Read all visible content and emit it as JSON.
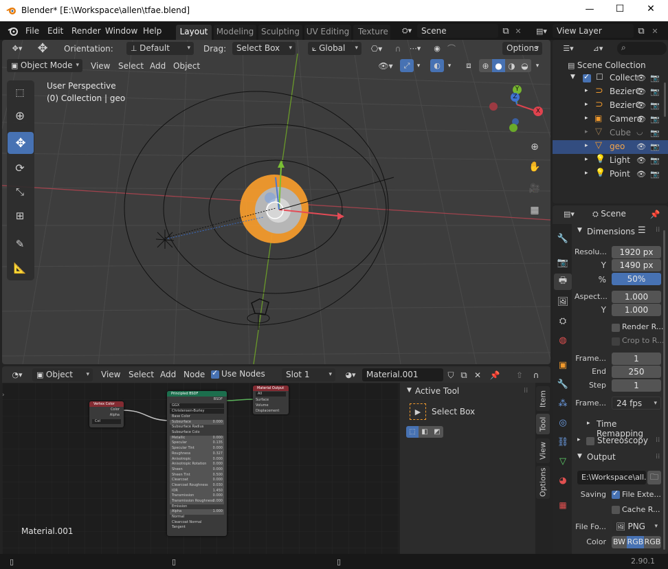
{
  "window": {
    "title": "Blender* [E:\\Workspace\\allen\\tfae.blend]",
    "minimize": "—",
    "maximize": "☐",
    "close": "✕"
  },
  "topbar": {
    "menus": [
      "File",
      "Edit",
      "Render",
      "Window",
      "Help"
    ],
    "workspaces": [
      "Layout",
      "Modeling",
      "Sculpting",
      "UV Editing",
      "Texture P"
    ],
    "active_workspace": "Layout",
    "scene": "Scene",
    "view_layer": "View Layer"
  },
  "tool_header": {
    "orientation_label": "Orientation:",
    "orientation_value": "Default",
    "drag_label": "Drag:",
    "drag_value": "Select Box",
    "transform_orientation": "Global",
    "options": "Options"
  },
  "viewport_header": {
    "mode": "Object Mode",
    "menus": [
      "View",
      "Select",
      "Add",
      "Object"
    ]
  },
  "viewport": {
    "perspective": "User Perspective",
    "collection_info": "(0) Collection | geo",
    "gizmo_axes": {
      "x": "X",
      "y": "Y",
      "z": "Z"
    }
  },
  "node_header": {
    "type": "Object",
    "menus": [
      "View",
      "Select",
      "Add",
      "Node"
    ],
    "use_nodes": "Use Nodes",
    "slot": "Slot 1",
    "material": "Material.001"
  },
  "node_editor": {
    "material_label": "Material.001",
    "nodes": {
      "vertex_color": {
        "title": "Vertex Color",
        "outputs": [
          "Color",
          "Alpha"
        ],
        "field": "Col"
      },
      "principled": {
        "title": "Principled BSDF",
        "output": "BSDF",
        "distribution": "GGX",
        "subsurface_method": "Christensen-Burley",
        "rows": [
          {
            "name": "Base Color",
            "value": ""
          },
          {
            "name": "Subsurface",
            "value": "0.000"
          },
          {
            "name": "Subsurface Radius",
            "value": ""
          },
          {
            "name": "Subsurface Colo",
            "value": ""
          },
          {
            "name": "Metallic",
            "value": "0.000"
          },
          {
            "name": "Specular",
            "value": "0.135"
          },
          {
            "name": "Specular Tint",
            "value": "0.000"
          },
          {
            "name": "Roughness",
            "value": "0.327"
          },
          {
            "name": "Anisotropic",
            "value": "0.000"
          },
          {
            "name": "Anisotropic Rotation",
            "value": "0.000"
          },
          {
            "name": "Sheen",
            "value": "0.000"
          },
          {
            "name": "Sheen Tint",
            "value": "0.500"
          },
          {
            "name": "Clearcoat",
            "value": "0.000"
          },
          {
            "name": "Clearcoat Roughness",
            "value": "0.030"
          },
          {
            "name": "IOR",
            "value": "1.450"
          },
          {
            "name": "Transmission",
            "value": "0.000"
          },
          {
            "name": "Transmission Roughness",
            "value": "0.000"
          },
          {
            "name": "Emission",
            "value": ""
          },
          {
            "name": "Alpha",
            "value": "1.000"
          },
          {
            "name": "Normal",
            "value": ""
          },
          {
            "name": "Clearcoat Normal",
            "value": ""
          },
          {
            "name": "Tangent",
            "value": ""
          }
        ]
      },
      "material_output": {
        "title": "Material Output",
        "target": "All",
        "inputs": [
          "Surface",
          "Volume",
          "Displacement"
        ]
      }
    }
  },
  "sidebar": {
    "tabs": [
      "Item",
      "Tool",
      "View",
      "Options"
    ],
    "active_tool_title": "Active Tool",
    "tool_name": "Select Box"
  },
  "outliner": {
    "root": "Scene Collection",
    "items": [
      {
        "name": "Collect",
        "kind": "collection",
        "selected": false
      },
      {
        "name": "BezierC",
        "kind": "curve",
        "selected": false
      },
      {
        "name": "BezierC",
        "kind": "curve",
        "selected": false
      },
      {
        "name": "Camera",
        "kind": "camera",
        "selected": false
      },
      {
        "name": "Cube",
        "kind": "mesh",
        "selected": false
      },
      {
        "name": "geo",
        "kind": "mesh",
        "selected": true
      },
      {
        "name": "Light",
        "kind": "light",
        "selected": false
      },
      {
        "name": "Point",
        "kind": "light",
        "selected": false
      }
    ]
  },
  "properties": {
    "context": "Scene",
    "dimensions_title": "Dimensions",
    "resolution_label": "Resolu...",
    "res_x": "1920 px",
    "y_label": "Y",
    "res_y": "1490 px",
    "percent_label": "%",
    "res_percent": "50%",
    "aspect_label": "Aspect...",
    "aspect_x": "1.000",
    "aspect_y": "1.000",
    "render_region": "Render R...",
    "crop": "Crop to R...",
    "frame_start_label": "Frame...",
    "frame_start": "1",
    "end_label": "End",
    "frame_end": "250",
    "step_label": "Step",
    "frame_step": "1",
    "frame_rate_label": "Frame...",
    "frame_rate": "24 fps",
    "time_remapping": "Time Remapping",
    "stereoscopy": "Stereoscopy",
    "output_title": "Output",
    "output_path": "E:\\Workspace\\all...",
    "saving_label": "Saving",
    "file_ext": "File Exte...",
    "cache_result": "Cache R...",
    "file_format_label": "File Fo...",
    "file_format": "PNG",
    "color_label": "Color",
    "color_modes": [
      "BW",
      "RGB",
      "RGB"
    ]
  },
  "statusbar": {
    "version": "2.90.1"
  }
}
